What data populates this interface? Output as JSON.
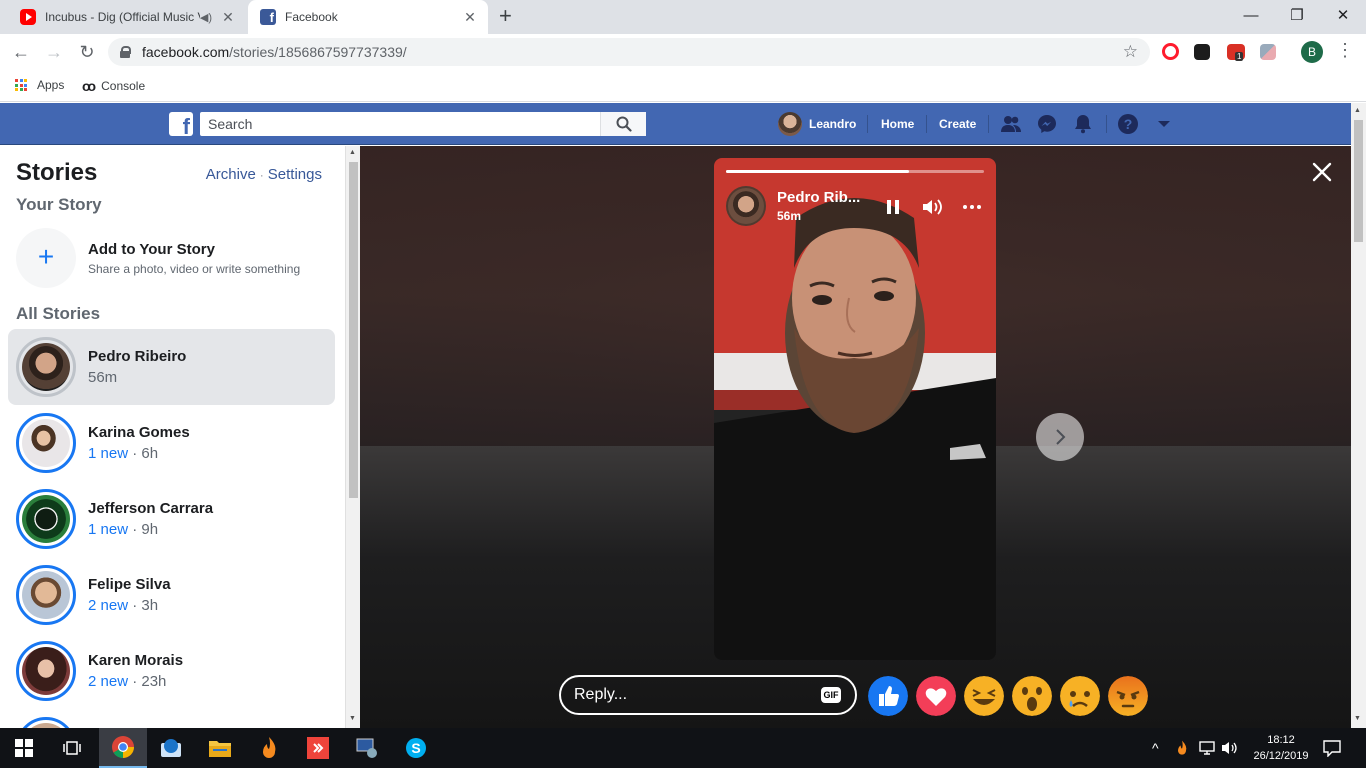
{
  "browser": {
    "tabs": [
      {
        "title": "Incubus - Dig (Official Music Video)",
        "audio_icon": "speaker-icon",
        "active": false
      },
      {
        "title": "Facebook",
        "active": true
      }
    ],
    "new_tab": "+",
    "url_host": "facebook.com",
    "url_path": "/stories/1856867597737339/",
    "profile_initial": "B",
    "extension_badge": "1",
    "bookmarks": [
      {
        "label": "Apps",
        "icon": "apps-grid-icon"
      },
      {
        "label": "Console",
        "icon": "infinity-icon"
      }
    ]
  },
  "fb_header": {
    "search_placeholder": "Search",
    "user_name": "Leandro",
    "nav_home": "Home",
    "nav_create": "Create",
    "brand_color": "#4267b2"
  },
  "sidebar": {
    "title": "Stories",
    "archive_link": "Archive",
    "settings_link": "Settings",
    "separator": "·",
    "your_story_heading": "Your Story",
    "add_story_title": "Add to Your Story",
    "add_story_subtitle": "Share a photo, video or write something",
    "all_stories_heading": "All Stories",
    "stories": [
      {
        "name": "Pedro Ribeiro",
        "new": "",
        "time": "56m",
        "selected": true
      },
      {
        "name": "Karina Gomes",
        "new": "1 new",
        "time": "6h",
        "selected": false
      },
      {
        "name": "Jefferson Carrara",
        "new": "1 new",
        "time": "9h",
        "selected": false
      },
      {
        "name": "Felipe Silva",
        "new": "2 new",
        "time": "3h",
        "selected": false
      },
      {
        "name": "Karen Morais",
        "new": "2 new",
        "time": "23h",
        "selected": false
      }
    ],
    "time_separator": " · "
  },
  "viewer": {
    "author_name": "Pedro Rib...",
    "author_time": "56m",
    "progress": 0.71,
    "reply_placeholder": "Reply...",
    "gif_label": "GIF",
    "reactions": [
      "like-icon",
      "love-icon",
      "haha-icon",
      "wow-icon",
      "sad-icon",
      "angry-icon"
    ]
  },
  "taskbar": {
    "time": "18:12",
    "date": "26/12/2019"
  }
}
